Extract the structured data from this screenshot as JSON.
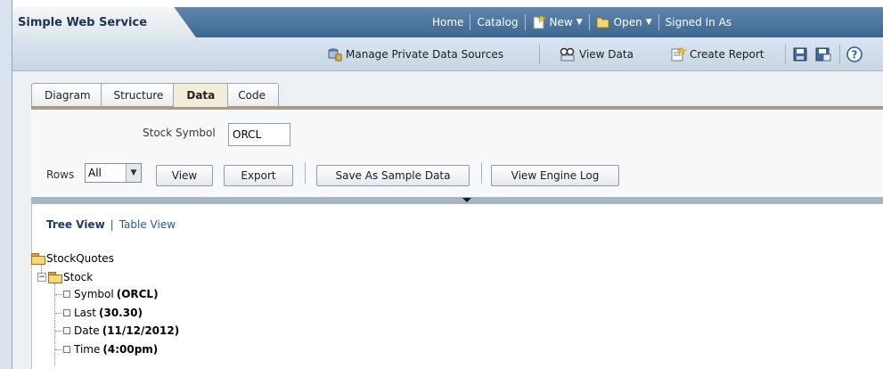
{
  "app": {
    "title": "Simple Web Service"
  },
  "global_nav": {
    "home": "Home",
    "catalog": "Catalog",
    "new": "New",
    "open": "Open",
    "signed_in": "Signed In As"
  },
  "toolbar": {
    "manage": "Manage Private Data Sources",
    "view_data": "View Data",
    "create_report": "Create Report"
  },
  "tabs": [
    {
      "label": "Diagram"
    },
    {
      "label": "Structure"
    },
    {
      "label": "Data"
    },
    {
      "label": "Code"
    }
  ],
  "form": {
    "stock_label": "Stock Symbol",
    "stock_value": "ORCL",
    "rows_label": "Rows",
    "rows_value": "All",
    "view_btn": "View",
    "export_btn": "Export",
    "sample_btn": "Save As Sample Data",
    "log_btn": "View Engine Log"
  },
  "views": {
    "tree": "Tree View",
    "sep": "|",
    "table": "Table View"
  },
  "tree": {
    "root": "StockQuotes",
    "child": "Stock",
    "leaves": [
      {
        "label": "Symbol",
        "value": "(ORCL)"
      },
      {
        "label": "Last",
        "value": "(30.30)"
      },
      {
        "label": "Date",
        "value": "(11/12/2012)"
      },
      {
        "label": "Time",
        "value": "(4:00pm)"
      }
    ]
  }
}
